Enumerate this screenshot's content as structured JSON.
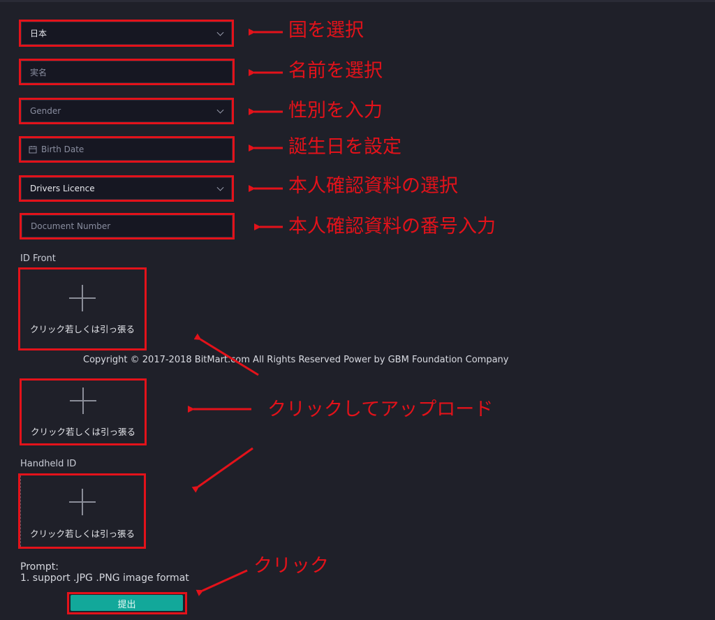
{
  "form": {
    "country": {
      "value": "日本"
    },
    "real_name": {
      "placeholder": "実名"
    },
    "gender": {
      "placeholder": "Gender"
    },
    "birth_date": {
      "placeholder": "Birth Date"
    },
    "document_type": {
      "value": "Drivers Licence"
    },
    "document_number": {
      "placeholder": "Document Number"
    }
  },
  "uploads": {
    "id_front_label": "ID Front",
    "handheld_label": "Handheld ID",
    "button_text": "クリック若しくは引っ張る"
  },
  "footer": {
    "copyright": "Copyright © 2017-2018 BitMart.com All Rights Reserved Power by GBM Foundation Company"
  },
  "prompt": {
    "title": "Prompt:",
    "line1": "1. support .JPG .PNG image format"
  },
  "submit": {
    "label": "提出"
  },
  "annotations": {
    "country": "国を選択",
    "name": "名前を選択",
    "gender": "性別を入力",
    "birth": "誕生日を設定",
    "doc_type": "本人確認資料の選択",
    "doc_number": "本人確認資料の番号入力",
    "upload": "クリックしてアップロード",
    "click": "クリック"
  },
  "colors": {
    "annotation": "#e3121a",
    "accent": "#12a89a",
    "background": "#1f2029"
  },
  "icons": [
    "chevron-down-icon",
    "calendar-icon",
    "plus-icon",
    "arrow-icon"
  ]
}
